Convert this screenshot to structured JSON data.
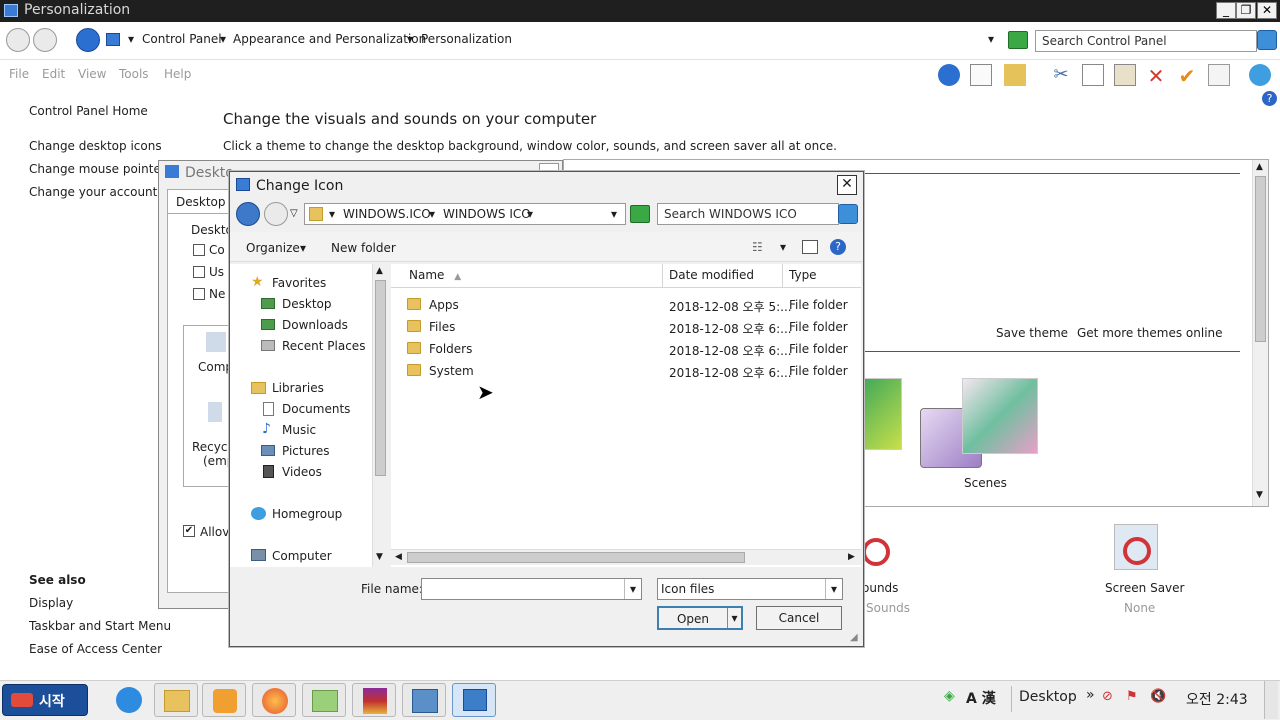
{
  "window": {
    "title": "Personalization"
  },
  "breadcrumb": [
    "Control Panel",
    "Appearance and Personalization",
    "Personalization"
  ],
  "search": {
    "placeholder": "Search Control Panel"
  },
  "menu": [
    "File",
    "Edit",
    "View",
    "Tools",
    "Help"
  ],
  "left_pane": {
    "home": "Control Panel Home",
    "links": [
      "Change desktop icons",
      "Change mouse pointers",
      "Change your account pi"
    ],
    "see_also_title": "See also",
    "see_also": [
      "Display",
      "Taskbar and Start Menu",
      "Ease of Access Center"
    ]
  },
  "main": {
    "heading": "Change the visuals and sounds on your computer",
    "subheading": "Click a theme to change the desktop background, window color, sounds, and screen saver all at once.",
    "save_theme": "Save theme",
    "get_more": "Get more themes online",
    "theme_scenes": "Scenes",
    "sounds_label": "ounds",
    "sounds_sub": "Sounds",
    "screensaver_label": "Screen Saver",
    "screensaver_value": "None"
  },
  "back_dialog": {
    "title": "Deskto",
    "tab": "Desktop Ic",
    "group": "Deskto",
    "checkboxes": [
      "Co",
      "Us",
      "Ne"
    ],
    "icons": [
      "Comp",
      "Recyc",
      "(emp"
    ],
    "allow": "Allov"
  },
  "icon_dialog": {
    "title": "Change Icon",
    "path": [
      "WINDOWS.ICO",
      "WINDOWS ICO"
    ],
    "search_placeholder": "Search WINDOWS ICO",
    "organize": "Organize",
    "new_folder": "New folder",
    "nav": {
      "favorites": "Favorites",
      "fav_items": [
        "Desktop",
        "Downloads",
        "Recent Places"
      ],
      "libraries": "Libraries",
      "lib_items": [
        "Documents",
        "Music",
        "Pictures",
        "Videos"
      ],
      "homegroup": "Homegroup",
      "computer": "Computer"
    },
    "columns": [
      "Name",
      "Date modified",
      "Type"
    ],
    "files": [
      {
        "name": "Apps",
        "date": "2018-12-08 오후 5:...",
        "type": "File folder"
      },
      {
        "name": "Files",
        "date": "2018-12-08 오후 6:...",
        "type": "File folder"
      },
      {
        "name": "Folders",
        "date": "2018-12-08 오후 6:...",
        "type": "File folder"
      },
      {
        "name": "System",
        "date": "2018-12-08 오후 6:...",
        "type": "File folder"
      }
    ],
    "file_name_label": "File name:",
    "file_name_value": "",
    "filter": "Icon files",
    "open": "Open",
    "cancel": "Cancel"
  },
  "taskbar": {
    "start": "시작",
    "tray_lang": "A 漢",
    "desktop": "Desktop",
    "clock": "오전 2:43"
  }
}
